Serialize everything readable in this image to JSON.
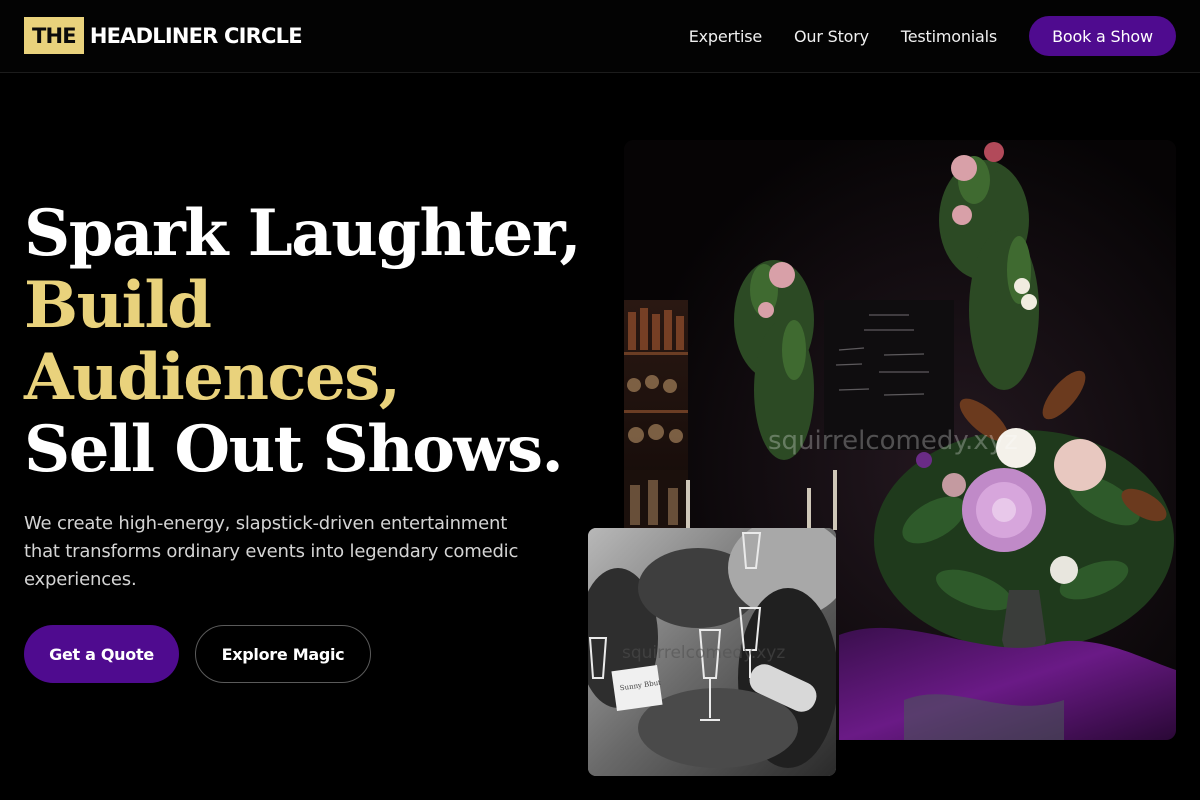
{
  "header": {
    "logo_badge": "THE",
    "logo_text": "HEADLINER CIRCLE",
    "nav": [
      "Expertise",
      "Our Story",
      "Testimonials"
    ],
    "cta": "Book a Show"
  },
  "hero": {
    "line1": "Spark Laughter,",
    "line2": "Build",
    "line3": "Audiences,",
    "line4": "Sell Out Shows.",
    "subtext": "We create high-energy, slapstick-driven entertainment that transforms ordinary events into legendary comedic experiences.",
    "primary_button": "Get a Quote",
    "secondary_button": "Explore Magic"
  },
  "images": {
    "large_watermark": "squirrelcomedy.xyz",
    "small_watermark": "squirrelcomedy.xyz",
    "small_card_text": "Sunny Bbut"
  },
  "colors": {
    "accent_gold": "#e9d27c",
    "brand_purple": "#4f0b8f",
    "background": "#000000"
  }
}
